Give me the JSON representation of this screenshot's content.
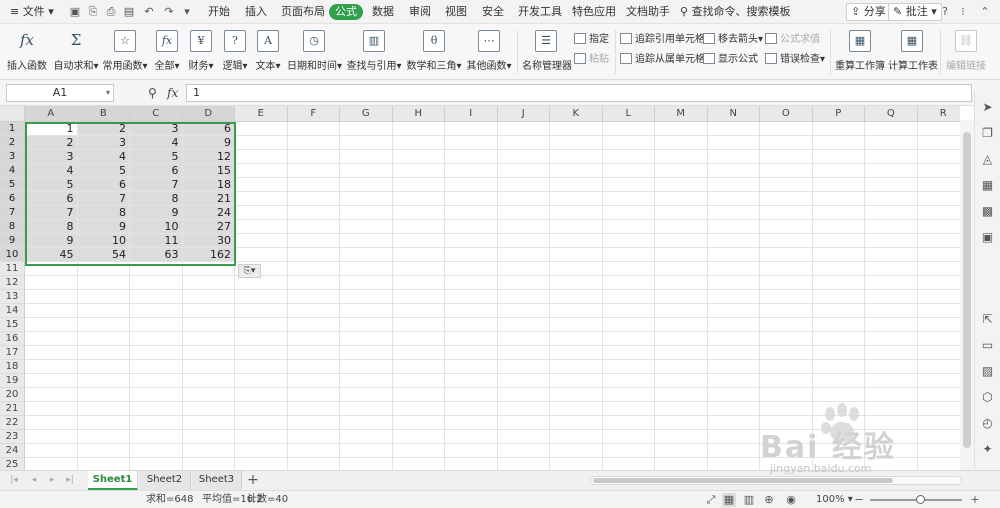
{
  "menubar": {
    "file": "文件",
    "tabs": [
      "开始",
      "插入",
      "页面布局",
      "公式",
      "数据",
      "审阅",
      "视图",
      "安全",
      "开发工具",
      "特色应用",
      "文档助手"
    ],
    "active_tab": "公式",
    "search": "查找命令、搜索模板",
    "share": "分享",
    "comment": "批注"
  },
  "ribbon": {
    "buttons": [
      "插入函数",
      "自动求和",
      "常用函数",
      "全部",
      "财务",
      "逻辑",
      "文本",
      "日期和时间",
      "查找与引用",
      "数学和三角",
      "其他函数",
      "名称管理器"
    ],
    "name_specify": "指定",
    "paste": "粘贴",
    "trace_precedents": "追踪引用单元格",
    "trace_dependents": "追踪从属单元格",
    "remove_arrows": "移去箭头",
    "show_formula": "显示公式",
    "formula_eval": "公式求值",
    "error_check": "错误检查",
    "recalc_workbook": "重算工作簿",
    "calc_sheet": "计算工作表",
    "edit_links": "编辑链接"
  },
  "formula_bar": {
    "name_box": "A1",
    "fx": "fx",
    "value": "1"
  },
  "columns": [
    "A",
    "B",
    "C",
    "D",
    "E",
    "F",
    "G",
    "H",
    "I",
    "J",
    "K",
    "L",
    "M",
    "N",
    "O",
    "P",
    "Q",
    "R"
  ],
  "rows": [
    "1",
    "2",
    "3",
    "4",
    "5",
    "6",
    "7",
    "8",
    "9",
    "10",
    "11",
    "12",
    "13",
    "14",
    "15",
    "16",
    "17",
    "18",
    "19",
    "20",
    "21",
    "22",
    "23",
    "24",
    "25"
  ],
  "cells": [
    [
      "1",
      "2",
      "3",
      "6"
    ],
    [
      "2",
      "3",
      "4",
      "9"
    ],
    [
      "3",
      "4",
      "5",
      "12"
    ],
    [
      "4",
      "5",
      "6",
      "15"
    ],
    [
      "5",
      "6",
      "7",
      "18"
    ],
    [
      "6",
      "7",
      "8",
      "21"
    ],
    [
      "7",
      "8",
      "9",
      "24"
    ],
    [
      "8",
      "9",
      "10",
      "27"
    ],
    [
      "9",
      "10",
      "11",
      "30"
    ],
    [
      "45",
      "54",
      "63",
      "162"
    ]
  ],
  "sheets": [
    "Sheet1",
    "Sheet2",
    "Sheet3"
  ],
  "active_sheet": "Sheet1",
  "status": {
    "sum": "求和=648",
    "avg": "平均值=16.2",
    "count": "计数=40",
    "zoom": "100%"
  },
  "watermark": {
    "text": "Bai 经验",
    "url": "jingyan.baidu.com"
  },
  "colors": {
    "accent": "#2fa04b",
    "selection_border": "#3d9a4d",
    "selection_fill": "#dcdcdc"
  }
}
